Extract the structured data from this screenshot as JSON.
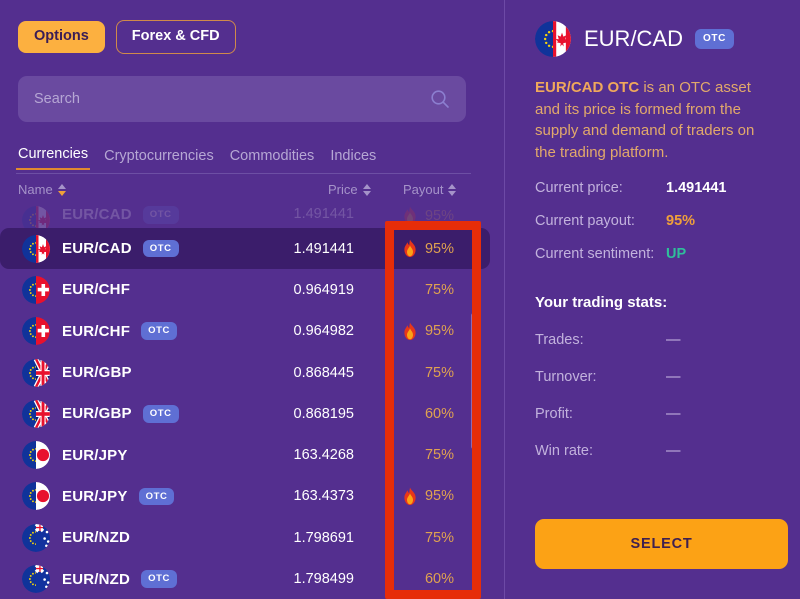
{
  "toolbar": {
    "options_label": "Options",
    "forex_label": "Forex & CFD"
  },
  "search": {
    "placeholder": "Search",
    "value": "",
    "icon": "search-icon"
  },
  "tabs": [
    {
      "label": "Currencies",
      "active": true
    },
    {
      "label": "Cryptocurrencies",
      "active": false
    },
    {
      "label": "Commodities",
      "active": false
    },
    {
      "label": "Indices",
      "active": false
    }
  ],
  "columns": {
    "name": "Name",
    "price": "Price",
    "payout": "Payout",
    "name_sort": "descending",
    "price_sort": "none",
    "payout_sort": "none"
  },
  "rows": [
    {
      "pair": "EUR/CAD",
      "otc": true,
      "price": "1.491441",
      "payout": "95%",
      "hot": true,
      "selected": false,
      "ghost": true,
      "flag": "eu-ca"
    },
    {
      "pair": "EUR/CAD",
      "otc": true,
      "price": "1.491441",
      "payout": "95%",
      "hot": true,
      "selected": true,
      "ghost": false,
      "flag": "eu-ca"
    },
    {
      "pair": "EUR/CHF",
      "otc": false,
      "price": "0.964919",
      "payout": "75%",
      "hot": false,
      "selected": false,
      "ghost": false,
      "flag": "eu-ch"
    },
    {
      "pair": "EUR/CHF",
      "otc": true,
      "price": "0.964982",
      "payout": "95%",
      "hot": true,
      "selected": false,
      "ghost": false,
      "flag": "eu-ch"
    },
    {
      "pair": "EUR/GBP",
      "otc": false,
      "price": "0.868445",
      "payout": "75%",
      "hot": false,
      "selected": false,
      "ghost": false,
      "flag": "eu-gb"
    },
    {
      "pair": "EUR/GBP",
      "otc": true,
      "price": "0.868195",
      "payout": "60%",
      "hot": false,
      "selected": false,
      "ghost": false,
      "flag": "eu-gb"
    },
    {
      "pair": "EUR/JPY",
      "otc": false,
      "price": "163.4268",
      "payout": "75%",
      "hot": false,
      "selected": false,
      "ghost": false,
      "flag": "eu-jp"
    },
    {
      "pair": "EUR/JPY",
      "otc": true,
      "price": "163.4373",
      "payout": "95%",
      "hot": true,
      "selected": false,
      "ghost": false,
      "flag": "eu-jp"
    },
    {
      "pair": "EUR/NZD",
      "otc": false,
      "price": "1.798691",
      "payout": "75%",
      "hot": false,
      "selected": false,
      "ghost": false,
      "flag": "eu-nz"
    },
    {
      "pair": "EUR/NZD",
      "otc": true,
      "price": "1.798499",
      "payout": "60%",
      "hot": false,
      "selected": false,
      "ghost": false,
      "flag": "eu-nz"
    }
  ],
  "detail": {
    "asset_name": "EUR/CAD",
    "otc_badge": "OTC",
    "flag": "eu-ca",
    "description_bold": "EUR/CAD OTC",
    "description_rest": " is an OTC asset and its price is formed from the supply and demand of traders on the trading platform.",
    "current_price_label": "Current price:",
    "current_price_value": "1.491441",
    "current_payout_label": "Current payout:",
    "current_payout_value": "95%",
    "current_sentiment_label": "Current sentiment:",
    "current_sentiment_value": "UP",
    "stats_title": "Your trading stats:",
    "stats": [
      {
        "label": "Trades:",
        "value": "—"
      },
      {
        "label": "Turnover:",
        "value": "—"
      },
      {
        "label": "Profit:",
        "value": "—"
      },
      {
        "label": "Win rate:",
        "value": "—"
      }
    ],
    "select_label": "SELECT"
  },
  "colors": {
    "background": "#542f8f",
    "accent_orange": "#fca215",
    "payout_text": "#e0a250",
    "otc_badge": "#5f6fd4",
    "selected_row": "#3b1d6b",
    "sentiment_up": "#2fbf9b",
    "annotation_box": "#e62d09"
  }
}
